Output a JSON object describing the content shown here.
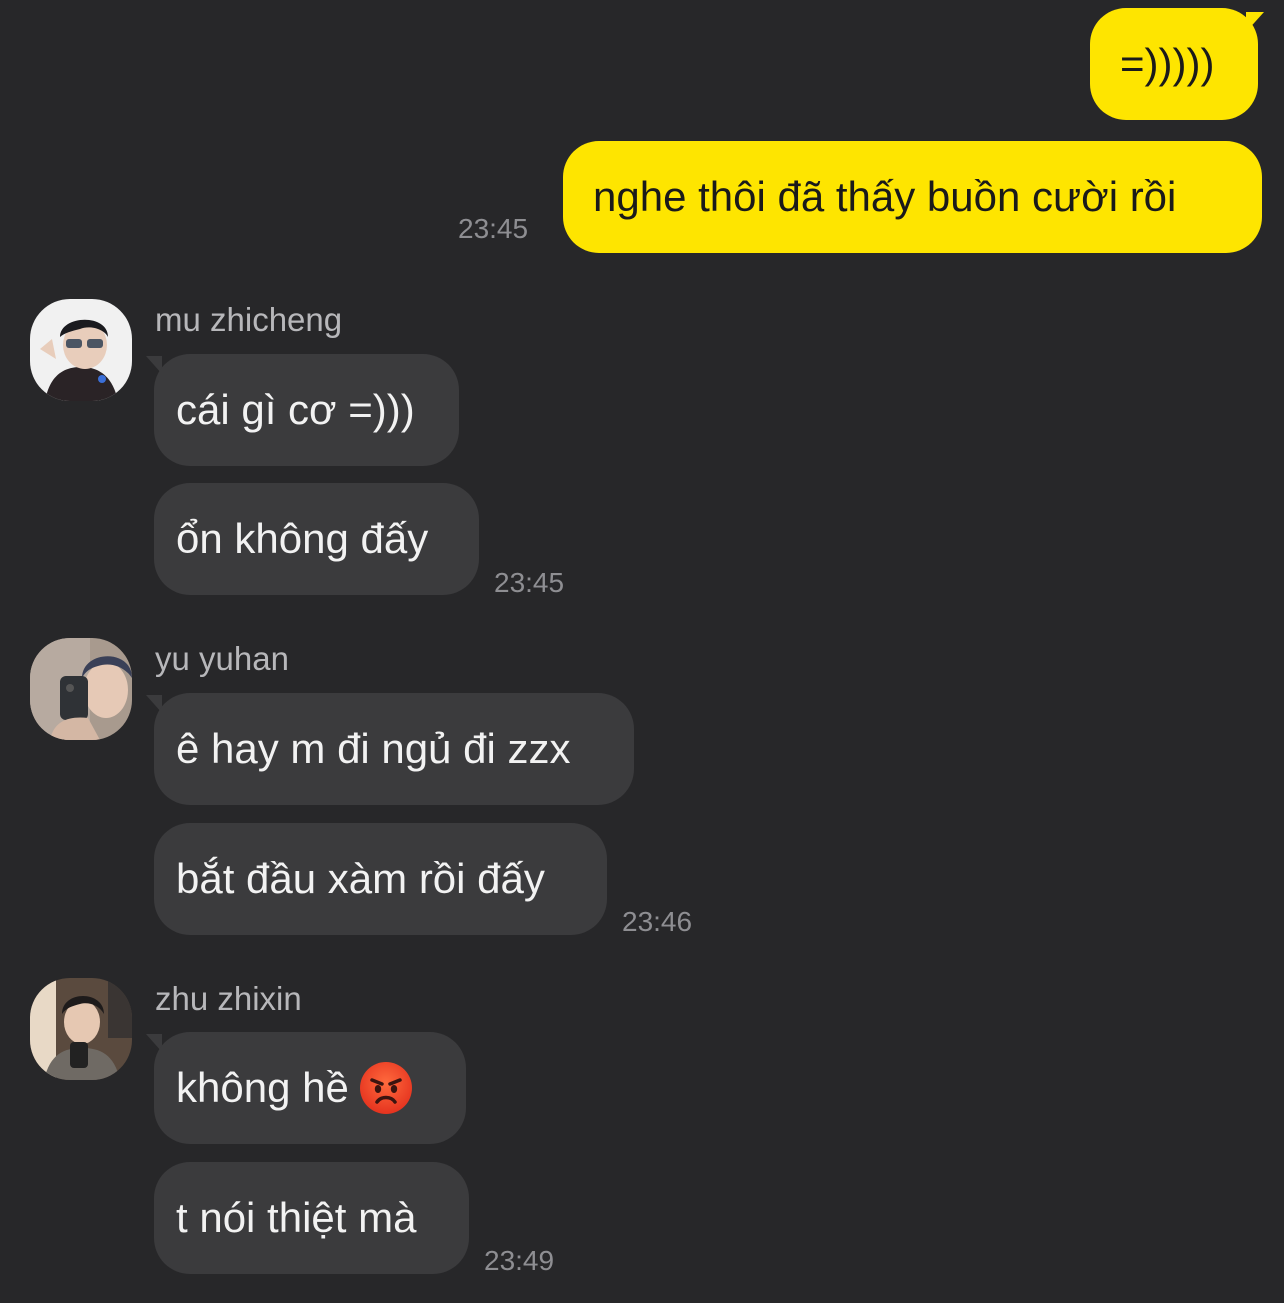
{
  "outgoing": {
    "messages": [
      "=)))))",
      "nghe thôi đã thấy buồn cười rồi"
    ],
    "time": "23:45"
  },
  "groups": [
    {
      "sender": "mu zhicheng",
      "avatar": "avatar-photo",
      "messages": [
        "cái gì cơ =)))",
        "ổn không đấy"
      ],
      "time": "23:45"
    },
    {
      "sender": "yu yuhan",
      "avatar": "avatar-photo",
      "messages": [
        "ê hay m đi ngủ đi zzx",
        "bắt đầu xàm rồi đấy"
      ],
      "time": "23:46"
    },
    {
      "sender": "zhu zhixin",
      "avatar": "avatar-photo",
      "messages": [
        "không hề",
        "t nói thiệt mà"
      ],
      "emoji": "angry-face-icon",
      "time": "23:49"
    }
  ],
  "colors": {
    "background": "#272729",
    "outgoing_bubble": "#FEE500",
    "incoming_bubble": "#3B3B3D",
    "timestamp": "#8E8E92",
    "sender_name": "#B7B7BA"
  }
}
